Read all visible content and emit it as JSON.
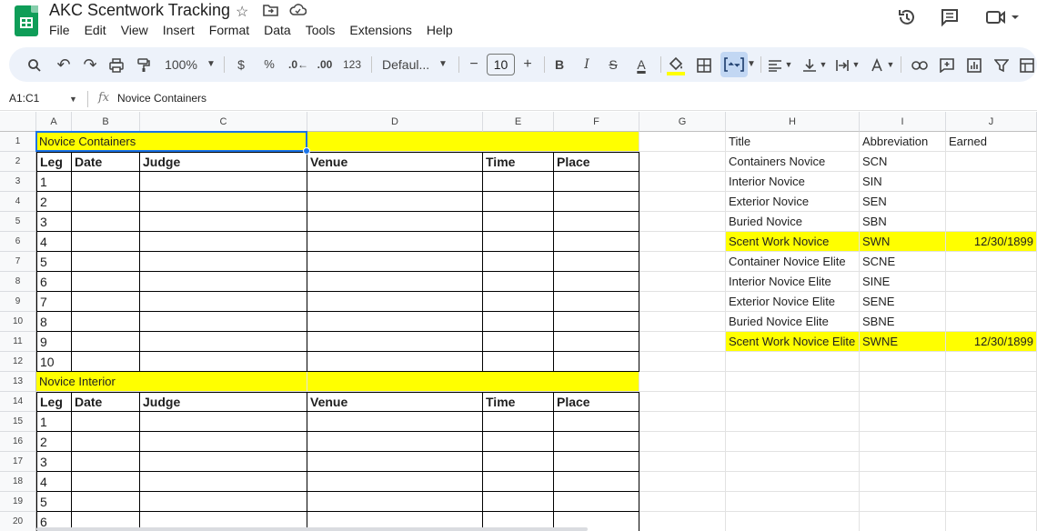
{
  "app": {
    "title": "AKC Scentwork Tracking",
    "menu": [
      "File",
      "Edit",
      "View",
      "Insert",
      "Format",
      "Data",
      "Tools",
      "Extensions",
      "Help"
    ]
  },
  "toolbar": {
    "zoom": "100%",
    "currency": "$",
    "percent": "%",
    "dec_decrease": ".0←",
    "dec_increase": ".00",
    "format_123": "123",
    "font": "Defaul...",
    "font_size": "10",
    "minus": "−",
    "plus": "+",
    "bold": "B",
    "italic": "I",
    "strike": "S",
    "text_color": "A"
  },
  "formula_bar": {
    "name_box": "A1:C1",
    "fx": "fx",
    "value": "Novice Containers"
  },
  "columns": [
    "A",
    "B",
    "C",
    "D",
    "E",
    "F",
    "G",
    "H",
    "I",
    "J"
  ],
  "rows": [
    "1",
    "2",
    "3",
    "4",
    "5",
    "6",
    "7",
    "8",
    "9",
    "10",
    "11",
    "12",
    "13",
    "14",
    "15",
    "16",
    "17",
    "18",
    "19",
    "20"
  ],
  "sheet": {
    "section1_title": "Novice Containers",
    "section2_title": "Novice Interior",
    "headers": [
      "Leg",
      "Date",
      "Judge",
      "Venue",
      "Time",
      "Place"
    ],
    "legs1": [
      "1",
      "2",
      "3",
      "4",
      "5",
      "6",
      "7",
      "8",
      "9",
      "10"
    ],
    "legs2": [
      "1",
      "2",
      "3",
      "4",
      "5",
      "6"
    ],
    "ref_headers": [
      "Title",
      "Abbreviation",
      "Earned"
    ],
    "ref_rows": [
      {
        "title": "Containers Novice",
        "abbr": "SCN",
        "earned": ""
      },
      {
        "title": "Interior Novice",
        "abbr": "SIN",
        "earned": ""
      },
      {
        "title": "Exterior Novice",
        "abbr": "SEN",
        "earned": ""
      },
      {
        "title": "Buried Novice",
        "abbr": "SBN",
        "earned": ""
      },
      {
        "title": "Scent Work Novice",
        "abbr": "SWN",
        "earned": "12/30/1899"
      },
      {
        "title": "Container Novice Elite",
        "abbr": "SCNE",
        "earned": ""
      },
      {
        "title": "Interior Novice Elite",
        "abbr": "SINE",
        "earned": ""
      },
      {
        "title": "Exterior Novice Elite",
        "abbr": "SENE",
        "earned": ""
      },
      {
        "title": "Buried Novice Elite",
        "abbr": "SBNE",
        "earned": ""
      },
      {
        "title": "Scent Work Novice Elite",
        "abbr": "SWNE",
        "earned": "12/30/1899"
      }
    ]
  },
  "colors": {
    "highlight": "#ffff00",
    "selection": "#1a73e8",
    "brand": "#0f9d58"
  }
}
